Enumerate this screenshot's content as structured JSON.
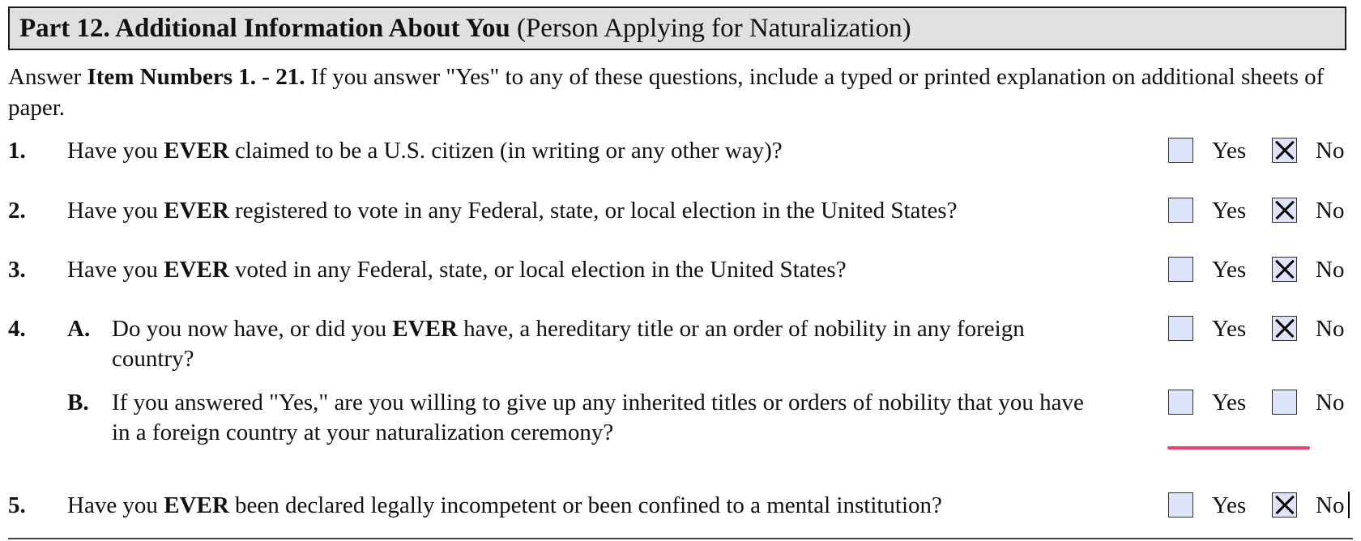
{
  "header": {
    "bold_title": "Part 12.  Additional Information About You",
    "subtitle": "(Person Applying for Naturalization)"
  },
  "instructions": {
    "prefix": "Answer ",
    "bold": "Item Numbers 1. - 21.",
    "rest": "  If you answer \"Yes\" to any of these questions, include a typed or printed explanation on additional sheets of paper."
  },
  "answer_labels": {
    "yes": "Yes",
    "no": "No"
  },
  "items": {
    "q1": {
      "number": "1.",
      "pre": "Have you ",
      "emph": "EVER",
      "post": " claimed to be a U.S. citizen (in writing or any other way)?",
      "yes_checked": false,
      "no_checked": true
    },
    "q2": {
      "number": "2.",
      "pre": "Have you ",
      "emph": "EVER",
      "post": " registered to vote in any Federal, state, or local election in the United States?",
      "yes_checked": false,
      "no_checked": true
    },
    "q3": {
      "number": "3.",
      "pre": "Have you ",
      "emph": "EVER",
      "post": " voted in any Federal, state, or local election in the United States?",
      "yes_checked": false,
      "no_checked": true
    },
    "q4": {
      "number": "4.",
      "a": {
        "letter": "A.",
        "pre": "Do you now have, or did you ",
        "emph": "EVER",
        "post": " have, a hereditary title or an order of nobility in any foreign country?",
        "yes_checked": false,
        "no_checked": true
      },
      "b": {
        "letter": "B.",
        "text": "If you answered \"Yes,\" are you willing to give up any inherited titles or orders of nobility that you have in a foreign country at your naturalization ceremony?",
        "yes_checked": false,
        "no_checked": false
      }
    },
    "q5": {
      "number": "5.",
      "pre": "Have you ",
      "emph": "EVER",
      "post": " been declared legally incompetent or been confined to a mental institution?",
      "yes_checked": false,
      "no_checked": true
    }
  },
  "colors": {
    "header_background": "#e0e0e0",
    "checkbox_fill": "#dde3f8",
    "highlight_underline": "#ec3f6e"
  }
}
